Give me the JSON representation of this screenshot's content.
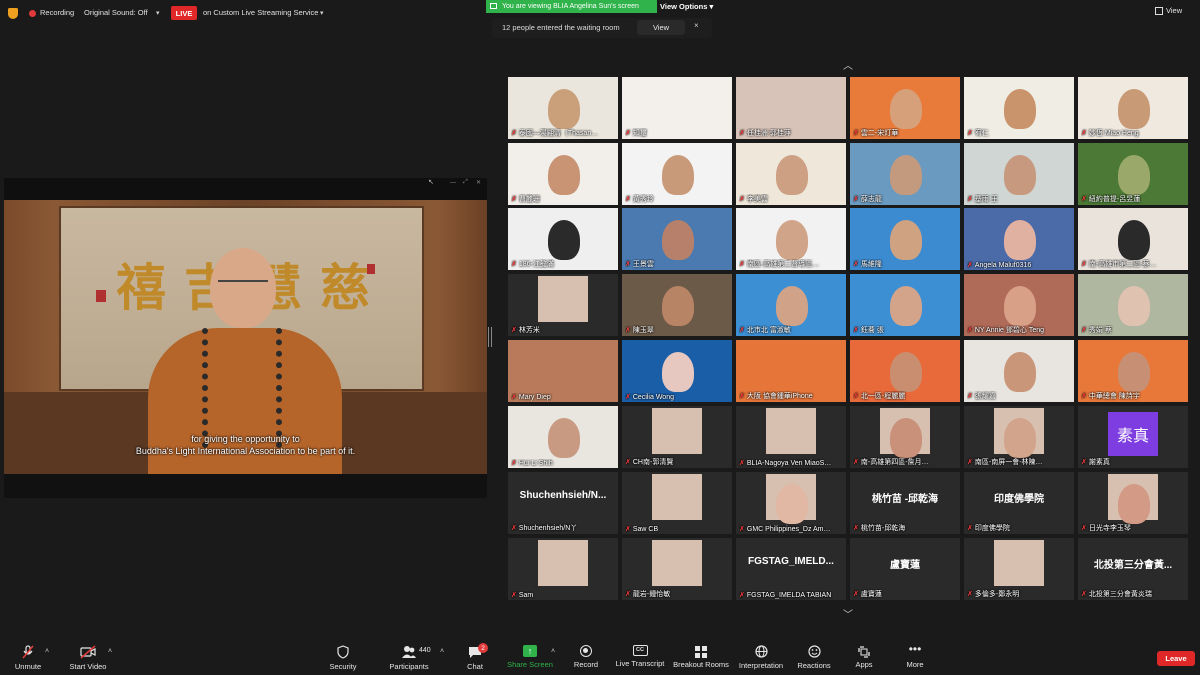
{
  "topbar": {
    "recording": "Recording",
    "original_sound": "Original Sound: Off",
    "live_badge": "LIVE",
    "live_service": "on Custom Live Streaming Service",
    "viewing_banner": "You are viewing BLIA Angelina Sun's screen",
    "view_options": "View Options",
    "view_right": "View",
    "accent_green": "#2fb34a",
    "live_red": "#e02828"
  },
  "waiting": {
    "message": "12 people entered the waiting room",
    "view_button": "View",
    "close": "×"
  },
  "share": {
    "subtitle_line1": "for giving the opportunity to",
    "subtitle_line2": "Buddha's Light International Association to be part of it.",
    "calligraphy": "禧吉慧慈"
  },
  "gallery": {
    "up": "︿",
    "down": "﹀",
    "tiles": [
      {
        "name": "泰國—湯翩清（Thasan…",
        "kind": "video",
        "bg": "#eae6dd",
        "head": "#caa07a"
      },
      {
        "name": "知璽",
        "kind": "video",
        "bg": "#f3f0ec",
        "head": ""
      },
      {
        "name": "任桂洲 郭桂萍",
        "kind": "video",
        "bg": "#d8c3b8",
        "head": ""
      },
      {
        "name": "雲二-宋灯華",
        "kind": "video",
        "bg": "#e87a3a",
        "head": "#d6a07a"
      },
      {
        "name": "宥仁",
        "kind": "video",
        "bg": "#f0ede4",
        "head": "#c9946c"
      },
      {
        "name": "妙恆 Miao Heng",
        "kind": "video",
        "bg": "#efe9e0",
        "head": "#c99a76"
      },
      {
        "name": "曹麗珊",
        "kind": "video",
        "bg": "#f2eeea",
        "head": "#c89474"
      },
      {
        "name": "黃秀玲",
        "kind": "video",
        "bg": "#f3f3f3",
        "head": "#c99a7a"
      },
      {
        "name": "李美雲",
        "kind": "video",
        "bg": "#efe7d9",
        "head": "#cda084"
      },
      {
        "name": "薛志龍",
        "kind": "video",
        "bg": "#6a9ac0",
        "head": "#c49a7e"
      },
      {
        "name": "基雨 王",
        "kind": "video",
        "bg": "#cfd6d4",
        "head": "#c79a80"
      },
      {
        "name": "紐約普提-呂昱蓮",
        "kind": "video",
        "bg": "#4c7a36",
        "head": "#9aa86a"
      },
      {
        "name": "186-江懿滿",
        "kind": "video",
        "bg": "#efefef",
        "head": "#2a2a2a"
      },
      {
        "name": "王景雲",
        "kind": "video",
        "bg": "#4a7ab0",
        "head": "#b6806a"
      },
      {
        "name": "南區-高雄第二督導區…",
        "kind": "video",
        "bg": "#f2f2f2",
        "head": "#d0a488"
      },
      {
        "name": "馬維隆",
        "kind": "video",
        "bg": "#3c8bd0",
        "head": "#cfa282"
      },
      {
        "name": "Angela Maluf0316",
        "kind": "video",
        "bg": "#4a6aa8",
        "head": "#e0b0a0"
      },
      {
        "name": "南-高雄市第二區-蔡…",
        "kind": "video",
        "bg": "#e9e3dc",
        "head": "#2a2a2a"
      },
      {
        "name": "林芳米",
        "kind": "video",
        "bg": "#2a2a2a",
        "head": ""
      },
      {
        "name": "陳玉翠",
        "kind": "video",
        "bg": "#6c5a48",
        "head": "#b88466"
      },
      {
        "name": "北市北 富淑敏",
        "kind": "video",
        "bg": "#3d8fd4",
        "head": "#d0a288"
      },
      {
        "name": "鈺蕎 張",
        "kind": "video",
        "bg": "#3d8fd4",
        "head": "#d4a48a"
      },
      {
        "name": "NY Annie 鄧碧心 Teng",
        "kind": "video",
        "bg": "#b06a58",
        "head": "#d9a088"
      },
      {
        "name": "秀娟 蔡",
        "kind": "video",
        "bg": "#b0b7a0",
        "head": "#e0c2b0"
      },
      {
        "name": "Mary Diep",
        "kind": "video",
        "bg": "#b87a5a",
        "head": ""
      },
      {
        "name": "Cecilia Wong",
        "kind": "video",
        "bg": "#1a5ea8",
        "head": "#e6c8c0"
      },
      {
        "name": "大阪 協會鍾華iPhone",
        "kind": "video",
        "bg": "#e6753a",
        "head": ""
      },
      {
        "name": "北一區-程麗麗",
        "kind": "video",
        "bg": "#e86a3a",
        "head": "#c98e70"
      },
      {
        "name": "張耀嘉",
        "kind": "video",
        "bg": "#e8e4e0",
        "head": "#c9967a"
      },
      {
        "name": "中華總會 陳詩宇",
        "kind": "video",
        "bg": "#e8783a",
        "head": "#c79074"
      },
      {
        "name": "Hui Li Shih",
        "kind": "video",
        "bg": "#e9e6e0",
        "head": "#c99a82"
      },
      {
        "name": "CH南-郭清賢",
        "kind": "video",
        "bg": "#2a2a2a",
        "head": ""
      },
      {
        "name": "BLIA-Nagoya Ven MiaoS…",
        "kind": "video",
        "bg": "#2a2a2a",
        "head": ""
      },
      {
        "name": "南-高雄第四區-詹月…",
        "kind": "video",
        "bg": "#2a2a2a",
        "head": "#c9907a"
      },
      {
        "name": "南區-南屏一會-林陳…",
        "kind": "video",
        "bg": "#2a2a2a",
        "head": "#d2a48c"
      },
      {
        "name": "謝素真",
        "kind": "purple",
        "bg": "#2a2a2a",
        "head": "",
        "avatar": "素真"
      },
      {
        "name": "Shuchenhsieh/N丫",
        "kind": "text",
        "bg": "#2a2a2a",
        "big": "Shuchenhsieh/N..."
      },
      {
        "name": "Saw CB",
        "kind": "video",
        "bg": "#2a2a2a",
        "head": ""
      },
      {
        "name": "GMC Philippines_Dz Am…",
        "kind": "video",
        "bg": "#2a2a2a",
        "head": "#e0b8a4"
      },
      {
        "name": "桃竹苗-邱乾海",
        "kind": "text",
        "bg": "#2a2a2a",
        "big": "桃竹苗 -邱乾海"
      },
      {
        "name": "印度佛學院",
        "kind": "text",
        "bg": "#2a2a2a",
        "big": "印度佛學院"
      },
      {
        "name": "日光寺李玉琴",
        "kind": "video",
        "bg": "#2a2a2a",
        "head": "#d39a86"
      },
      {
        "name": "Sam",
        "kind": "video",
        "bg": "#2a2a2a",
        "head": ""
      },
      {
        "name": "龍岩-鍾怡敏",
        "kind": "video",
        "bg": "#2a2a2a",
        "head": ""
      },
      {
        "name": "FGSTAG_IMELDA TABIAN",
        "kind": "text",
        "bg": "#2a2a2a",
        "big": "FGSTAG_IMELD..."
      },
      {
        "name": "盧寶蓮",
        "kind": "text",
        "bg": "#2a2a2a",
        "big": "盧寶蓮"
      },
      {
        "name": "多倫多-鄭永明",
        "kind": "video",
        "bg": "#2a2a2a",
        "head": ""
      },
      {
        "name": "北投第三分會黃炎瑞",
        "kind": "text",
        "bg": "#2a2a2a",
        "big": "北投第三分會黃..."
      }
    ]
  },
  "toolbar": {
    "unmute": "Unmute",
    "start_video": "Start Video",
    "security": "Security",
    "participants": "Participants",
    "participants_count": "440",
    "chat": "Chat",
    "chat_badge": "2",
    "share_screen": "Share Screen",
    "record": "Record",
    "live_transcript": "Live Transcript",
    "breakout_rooms": "Breakout Rooms",
    "interpretation": "Interpretation",
    "reactions": "Reactions",
    "apps": "Apps",
    "more": "More",
    "leave": "Leave",
    "cc": "CC"
  }
}
